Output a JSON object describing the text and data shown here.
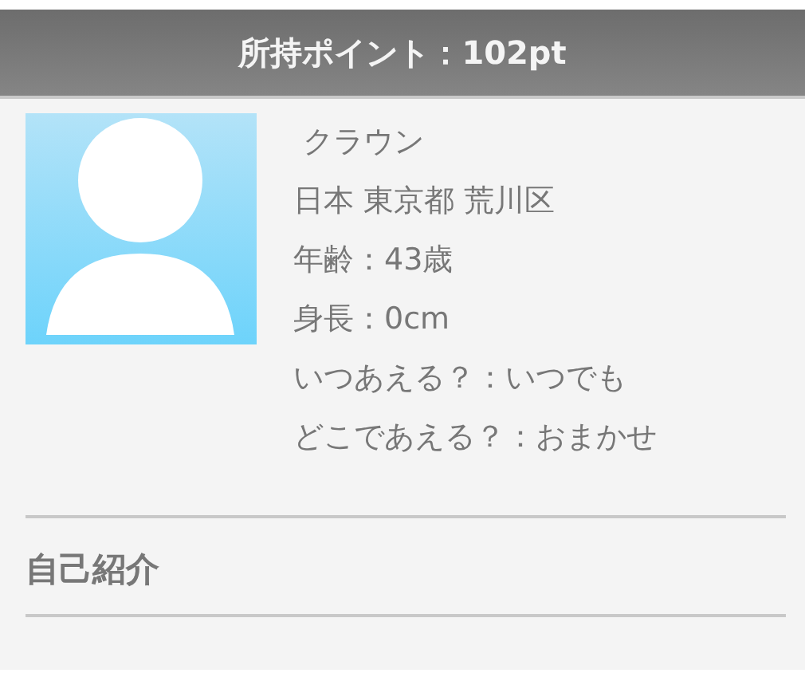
{
  "header": {
    "title": "所持ポイント：102pt"
  },
  "profile": {
    "name": "クラウン",
    "details": [
      "日本 東京都 荒川区",
      "年齢：43歳",
      "身長：0cm",
      "いつあえる？：いつでも",
      "どこであえる？：おまかせ"
    ]
  },
  "sections": [
    {
      "title": "自己紹介"
    }
  ]
}
